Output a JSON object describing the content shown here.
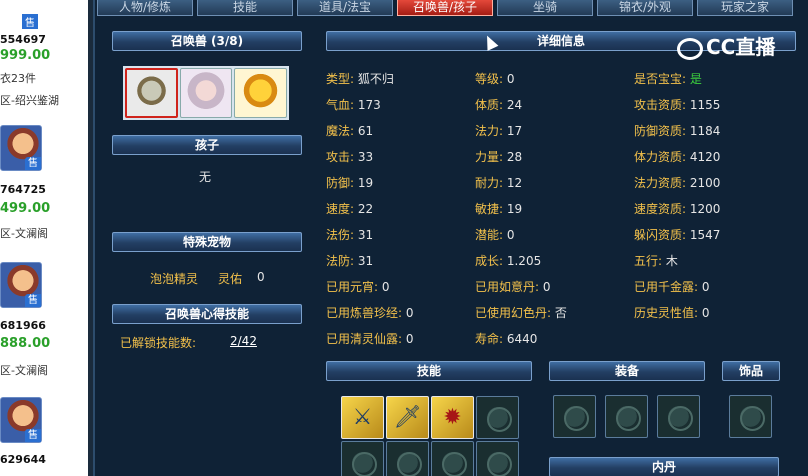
{
  "tabs": [
    "人物/修炼",
    "技能",
    "道具/法宝",
    "召唤兽/孩子",
    "坐骑",
    "锦衣/外观",
    "玩家之家"
  ],
  "watermark": "CC直播",
  "listings": [
    {
      "badge": "售",
      "id": "554697",
      "price": "999.00",
      "note": "衣23件",
      "location": "区-绍兴鉴湖"
    },
    {
      "badge": "售",
      "id": "764725",
      "price": "499.00",
      "location": "区-文澜阁"
    },
    {
      "badge": "售",
      "id": "681966",
      "price": "888.00",
      "location": "区-文澜阁"
    },
    {
      "badge": "售",
      "id": "629644"
    }
  ],
  "panel": {
    "summon_header": "召唤兽 (3/8)",
    "child_header": "孩子",
    "child_value": "无",
    "special_header": "特殊宠物",
    "special_name": "泡泡精灵",
    "special_stat_label": "灵佑",
    "special_stat_value": "0",
    "insight_header": "召唤兽心得技能",
    "unlocked_label": "已解锁技能数:",
    "unlocked_value": "2/42",
    "detail_header": "详细信息",
    "skills_header": "技能",
    "equip_header": "装备",
    "accessory_header": "饰品",
    "neidan_header": "内丹"
  },
  "stats": [
    [
      {
        "k": "类型: ",
        "v": "狐不归"
      },
      {
        "k": "等级: ",
        "v": "0"
      },
      {
        "k": "是否宝宝: ",
        "v": "是"
      }
    ],
    [
      {
        "k": "气血: ",
        "v": "173"
      },
      {
        "k": "体质: ",
        "v": "24"
      },
      {
        "k": "攻击资质: ",
        "v": "1155"
      }
    ],
    [
      {
        "k": "魔法: ",
        "v": "61"
      },
      {
        "k": "法力: ",
        "v": "17"
      },
      {
        "k": "防御资质: ",
        "v": "1184"
      }
    ],
    [
      {
        "k": "攻击: ",
        "v": "33"
      },
      {
        "k": "力量: ",
        "v": "28"
      },
      {
        "k": "体力资质: ",
        "v": "4120"
      }
    ],
    [
      {
        "k": "防御: ",
        "v": "19"
      },
      {
        "k": "耐力: ",
        "v": "12"
      },
      {
        "k": "法力资质: ",
        "v": "2100"
      }
    ],
    [
      {
        "k": "速度: ",
        "v": "22"
      },
      {
        "k": "敏捷: ",
        "v": "19"
      },
      {
        "k": "速度资质: ",
        "v": "1200"
      }
    ],
    [
      {
        "k": "法伤: ",
        "v": "31"
      },
      {
        "k": "潜能: ",
        "v": "0"
      },
      {
        "k": "躲闪资质: ",
        "v": "1547"
      }
    ],
    [
      {
        "k": "法防: ",
        "v": "31"
      },
      {
        "k": "成长: ",
        "v": "1.205"
      },
      {
        "k": "五行: ",
        "v": "木"
      }
    ],
    [
      {
        "k": "已用元宵: ",
        "v": "0"
      },
      {
        "k": "已用如意丹: ",
        "v": "0"
      },
      {
        "k": "已用千金露: ",
        "v": "0"
      }
    ],
    [
      {
        "k": "已用炼兽珍经: ",
        "v": "0"
      },
      {
        "k": "已使用幻色丹: ",
        "v": "否"
      },
      {
        "k": "历史灵性值: ",
        "v": "0"
      }
    ],
    [
      {
        "k": "已用清灵仙露: ",
        "v": "0"
      },
      {
        "k": "寿命: ",
        "v": "6440"
      }
    ]
  ]
}
